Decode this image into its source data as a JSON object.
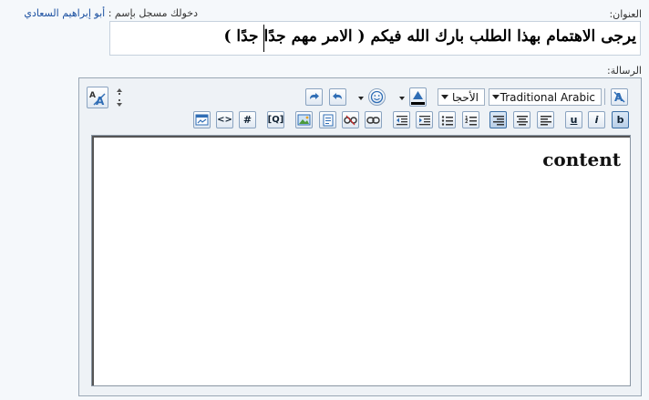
{
  "form": {
    "title_label": "العنوان:",
    "message_label": "الرسالة:",
    "logged_in_prefix": "دخولك مسجل بإسم :",
    "username": "أبو إبراهيم السعادي",
    "title_value": "يرجى الاهتمام بهذا الطلب بارك الله فيكم ( الامر مهم جدًا جدًا )"
  },
  "toolbar": {
    "font_name": "Traditional Arabic",
    "font_size": "الأحجا",
    "color_swatch": "#000000",
    "accent_color": "#2f6db5"
  },
  "editor": {
    "content": "content"
  },
  "icons": [
    "remove-format-icon",
    "font-name-select",
    "font-size-select",
    "text-color-icon",
    "smiley-icon",
    "undo-icon",
    "redo-icon",
    "resize-icon",
    "mode-switch-icon",
    "bold-icon",
    "italic-icon",
    "underline-icon",
    "align-right-icon",
    "align-center-icon",
    "align-left-icon",
    "ordered-list-icon",
    "unordered-list-icon",
    "indent-icon",
    "outdent-icon",
    "link-icon",
    "unlink-icon",
    "email-icon",
    "image-icon",
    "quote-icon",
    "code-icon",
    "html-icon",
    "php-icon"
  ]
}
